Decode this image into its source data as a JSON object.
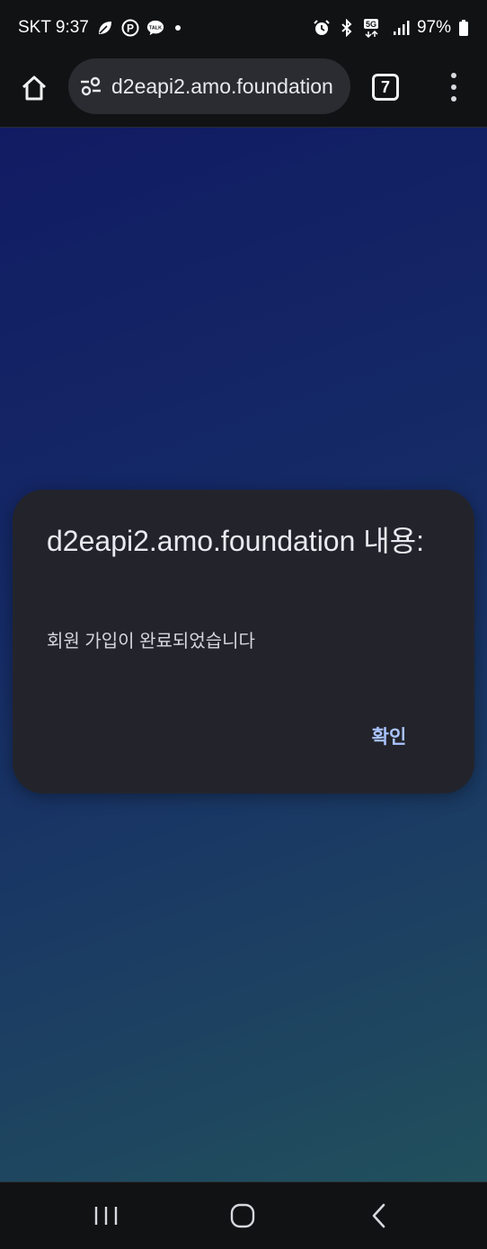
{
  "status_bar": {
    "carrier_time": "SKT 9:37",
    "battery": "97%",
    "network_badge": "5G",
    "icons_left": [
      "leaf-icon",
      "p-badge-icon",
      "talk-icon",
      "dot-indicator"
    ],
    "icons_right": [
      "alarm-icon",
      "bluetooth-icon",
      "5g-icon",
      "signal-icon",
      "battery-icon"
    ]
  },
  "toolbar": {
    "url": "d2eapi2.amo.foundation",
    "tab_count": "7",
    "icons": [
      "home-icon",
      "site-settings-icon",
      "tabs-icon",
      "more-vert-icon"
    ]
  },
  "dialog": {
    "title": "d2eapi2.amo.foundation 내용:",
    "message": "회원 가입이 완료되었습니다",
    "ok_label": "확인",
    "accent_color": "#a9c3ff",
    "background_color": "#23242b"
  },
  "nav_bar": {
    "icons": [
      "recent-apps-icon",
      "home-circle-icon",
      "back-chevron-icon"
    ]
  }
}
